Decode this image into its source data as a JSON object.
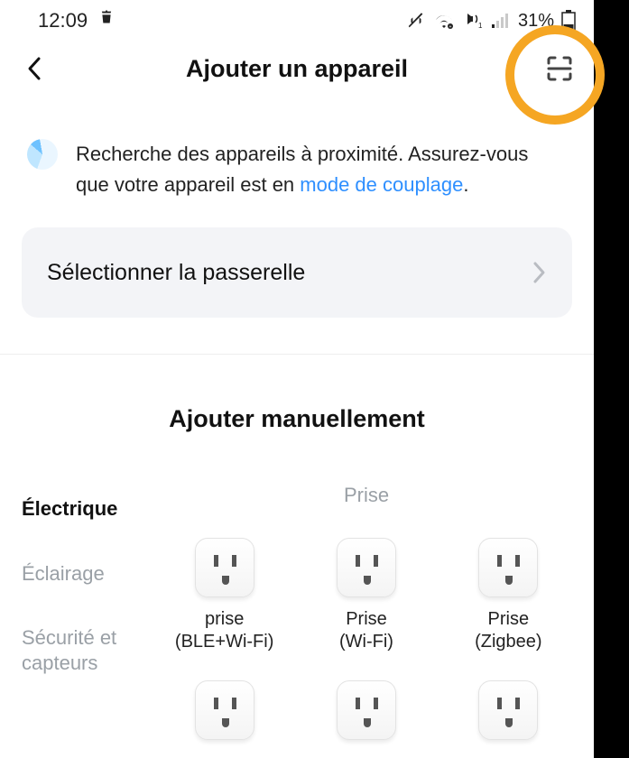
{
  "statusbar": {
    "time": "12:09",
    "battery_pct": "31%"
  },
  "header": {
    "title": "Ajouter un appareil"
  },
  "info": {
    "text_before_link": "Recherche des appareils à proximité. Assurez-vous que votre appareil est en ",
    "link_text": "mode de couplage",
    "text_after_link": "."
  },
  "gateway": {
    "label": "Sélectionner la passerelle"
  },
  "manual": {
    "title": "Ajouter manuellement"
  },
  "categories": {
    "items": [
      {
        "label": "Électrique",
        "active": true
      },
      {
        "label": "Éclairage",
        "active": false
      },
      {
        "label": "Sécurité et capteurs",
        "active": false
      }
    ]
  },
  "section": {
    "label": "Prise"
  },
  "products": [
    {
      "name": "prise\n(BLE+Wi-Fi)"
    },
    {
      "name": "Prise\n(Wi-Fi)"
    },
    {
      "name": "Prise\n(Zigbee)"
    }
  ]
}
